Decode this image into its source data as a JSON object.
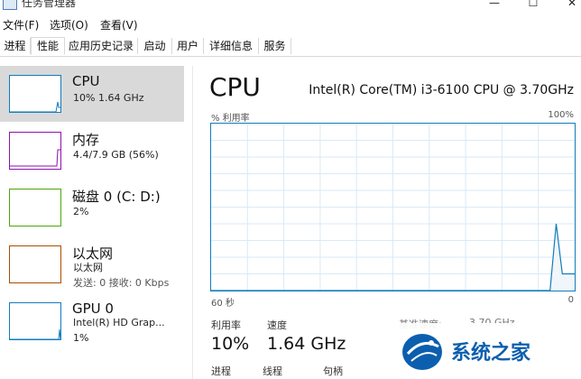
{
  "window": {
    "title": "任务管理器"
  },
  "menu": [
    {
      "label": "文件(F)"
    },
    {
      "label": "选项(O)"
    },
    {
      "label": "查看(V)"
    }
  ],
  "tabs": [
    {
      "label": "进程"
    },
    {
      "label": "性能"
    },
    {
      "label": "应用历史记录"
    },
    {
      "label": "启动"
    },
    {
      "label": "用户"
    },
    {
      "label": "详细信息"
    },
    {
      "label": "服务"
    }
  ],
  "active_tab": "性能",
  "sidebar": {
    "items": [
      {
        "name": "CPU",
        "sub1": "10%  1.64 GHz",
        "color": "#117dbb",
        "selected": true
      },
      {
        "name": "内存",
        "sub1": "4.4/7.9 GB (56%)",
        "color": "#8b12ae",
        "selected": false
      },
      {
        "name": "磁盘 0 (C: D:)",
        "sub1": "2%",
        "color": "#4da60c",
        "selected": false
      },
      {
        "name": "以太网",
        "sub1": "以太网",
        "sub2": "发送: 0  接收: 0 Kbps",
        "color": "#a74f01",
        "selected": false
      },
      {
        "name": "GPU 0",
        "sub1": "Intel(R) HD Grap...",
        "sub2": "1%",
        "color": "#117dbb",
        "selected": false
      }
    ]
  },
  "main": {
    "title": "CPU",
    "model": "Intel(R) Core(TM) i3-6100 CPU @ 3.70GHz",
    "graph": {
      "y_label": "% 利用率",
      "y_max_label": "100%",
      "x_left_label": "60 秒",
      "x_right_label": "0",
      "line_color": "#117dbb",
      "grid_color": "#d9eaf7",
      "recent_values_percent": [
        0,
        0,
        0,
        0,
        0,
        0,
        0,
        0,
        0,
        0,
        0,
        0,
        0,
        0,
        0,
        0,
        0,
        0,
        0,
        0,
        0,
        0,
        0,
        0,
        0,
        0,
        0,
        0,
        0,
        0,
        0,
        0,
        0,
        0,
        0,
        0,
        0,
        0,
        0,
        0,
        0,
        0,
        0,
        0,
        0,
        0,
        0,
        0,
        0,
        0,
        0,
        0,
        0,
        0,
        0,
        0,
        40,
        10,
        10,
        10
      ]
    },
    "stats": {
      "util_label": "利用率",
      "util_value": "10%",
      "speed_label": "速度",
      "speed_value": "1.64 GHz",
      "base_speed_label": "基准速度:",
      "base_speed_value": "3.70 GHz",
      "process_label": "进程",
      "thread_label": "线程",
      "handle_label": "句柄"
    }
  },
  "watermark": {
    "text": "系统之家",
    "color": "#0b5fae"
  },
  "icons": {
    "minimize": "minimize-icon",
    "maximize": "maximize-icon",
    "close": "close-icon"
  }
}
